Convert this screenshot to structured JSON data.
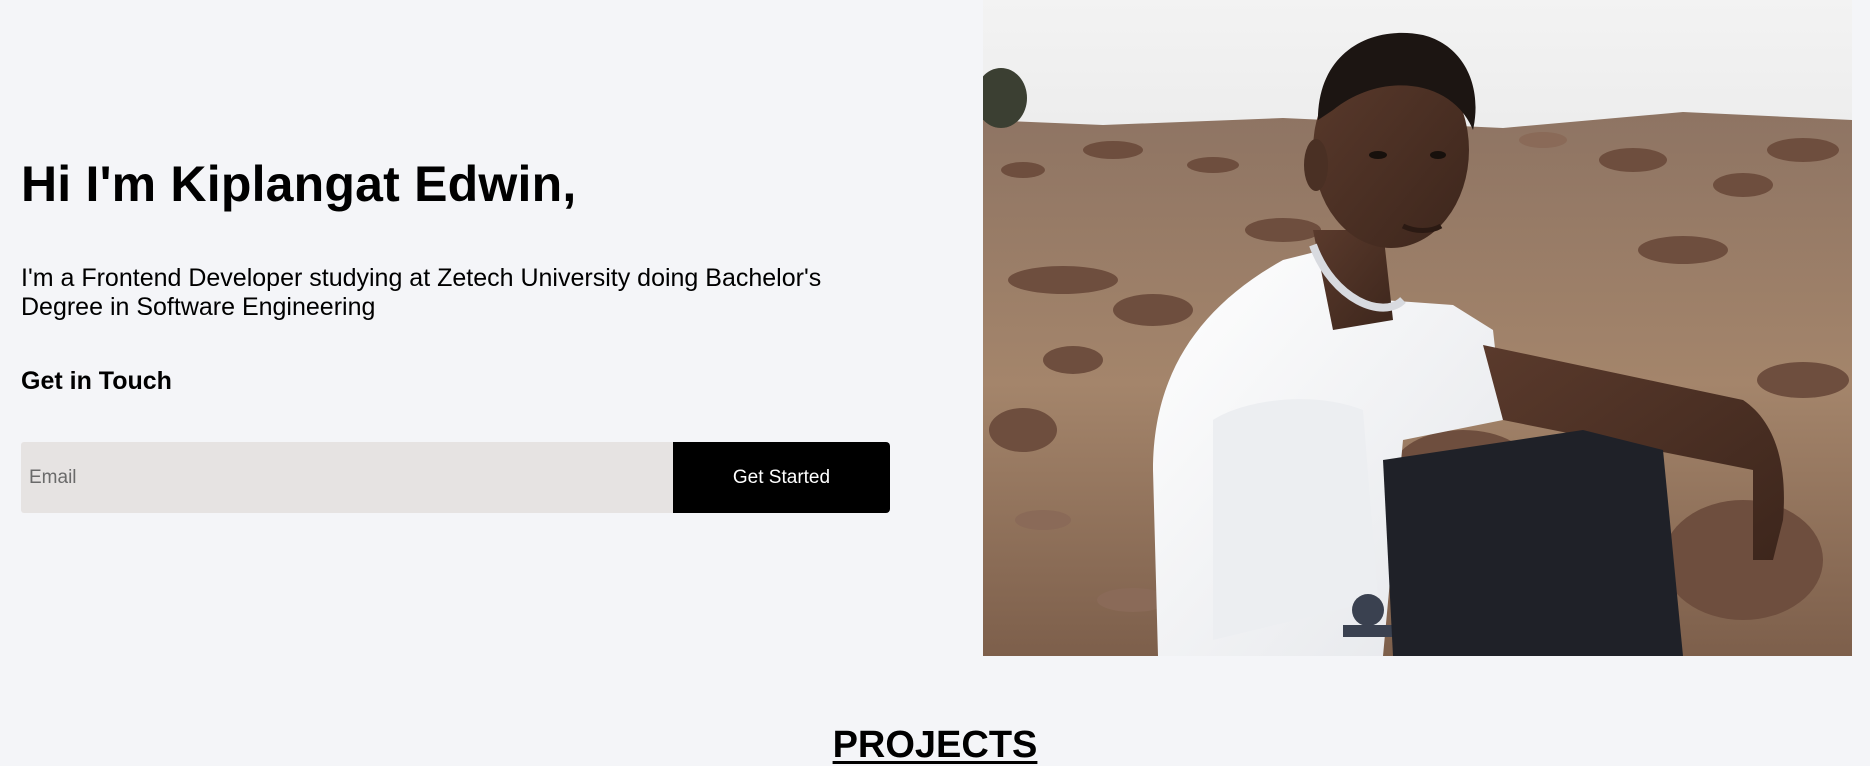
{
  "hero": {
    "title": "Hi I'm Kiplangat Edwin,",
    "subtitle": "I'm a Frontend Developer studying at Zetech University doing Bachelor's Degree in Software Engineering",
    "contact_heading": "Get in Touch",
    "email_placeholder": "Email",
    "cta_label": "Get Started",
    "photo_icon": "portrait-photo"
  },
  "sections": {
    "projects_heading": "PROJECTS"
  },
  "colors": {
    "background": "#f4f5f8",
    "input_background": "#e6e3e2",
    "button_background": "#000000",
    "button_text": "#ffffff"
  }
}
